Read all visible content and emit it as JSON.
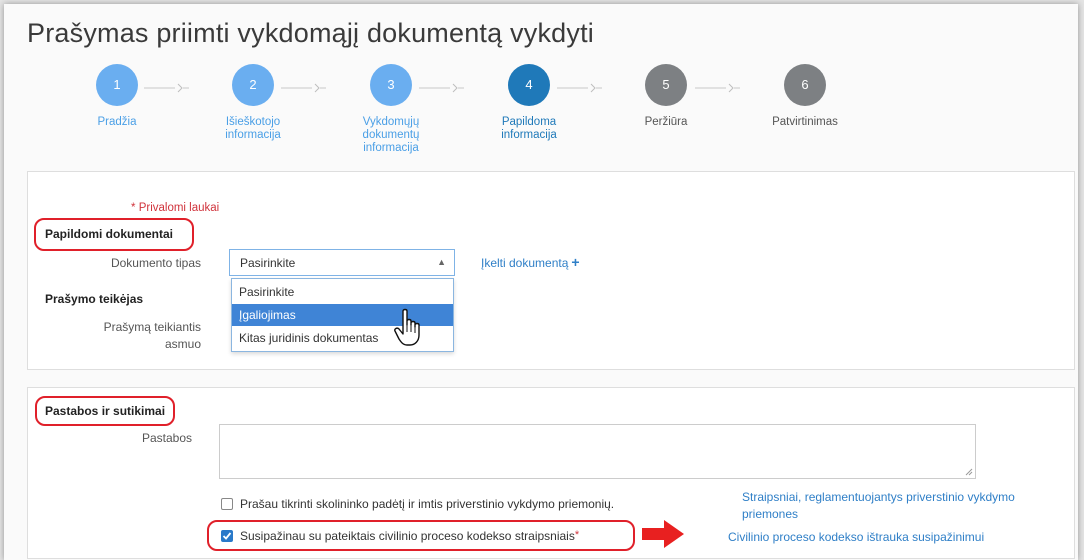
{
  "page": {
    "title": "Prašymas priimti vykdomąjį dokumentą vykdyti"
  },
  "colors": {
    "step_done": "#6aaef0",
    "step_active": "#1f79b9",
    "step_todo": "#7d8083",
    "link": "#2f7fc7",
    "required": "#d0333c",
    "highlight": "#e0202a"
  },
  "steps": [
    {
      "number": "1",
      "label": "Pradžia",
      "state": "done"
    },
    {
      "number": "2",
      "label": "Išieškotojo informacija",
      "state": "done"
    },
    {
      "number": "3",
      "label": "Vykdomųjų dokumentų informacija",
      "state": "done"
    },
    {
      "number": "4",
      "label": "Papildoma informacija",
      "state": "active"
    },
    {
      "number": "5",
      "label": "Peržiūra",
      "state": "todo"
    },
    {
      "number": "6",
      "label": "Patvirtinimas",
      "state": "todo"
    }
  ],
  "form": {
    "required_note": "Privalomi laukai",
    "required_star": "*",
    "section_docs": "Papildomi dokumentai",
    "doc_type_label": "Dokumento tipas",
    "doc_type_value": "Pasirinkite",
    "doc_type_caret": "▲",
    "upload_link": "Įkelti dokumentą",
    "upload_plus": "+",
    "dropdown_options": [
      "Pasirinkite",
      "Įgaliojimas",
      "Kitas juridinis dokumentas"
    ],
    "dropdown_highlighted_index": 1,
    "section_applicant": "Prašymo teikėjas",
    "applicant_label_line1": "Prašymą teikiantis",
    "applicant_label_line2": "asmuo",
    "section_notes": "Pastabos ir sutikimai",
    "notes_label": "Pastabos",
    "checkbox1_label": "Prašau tikrinti skolininko padėtį ir imtis priverstinio vykdymo priemonių.",
    "checkbox1_checked": false,
    "checkbox2_label": "Susipažinau su pateiktais civilinio proceso kodekso straipsniais",
    "checkbox2_checked": true,
    "link_articles_line1": "Straipsniai, reglamentuojantys priverstinio vykdymo",
    "link_articles_line2": "priemones",
    "link_extract": "Civilinio proceso kodekso ištrauka susipažinimui"
  }
}
